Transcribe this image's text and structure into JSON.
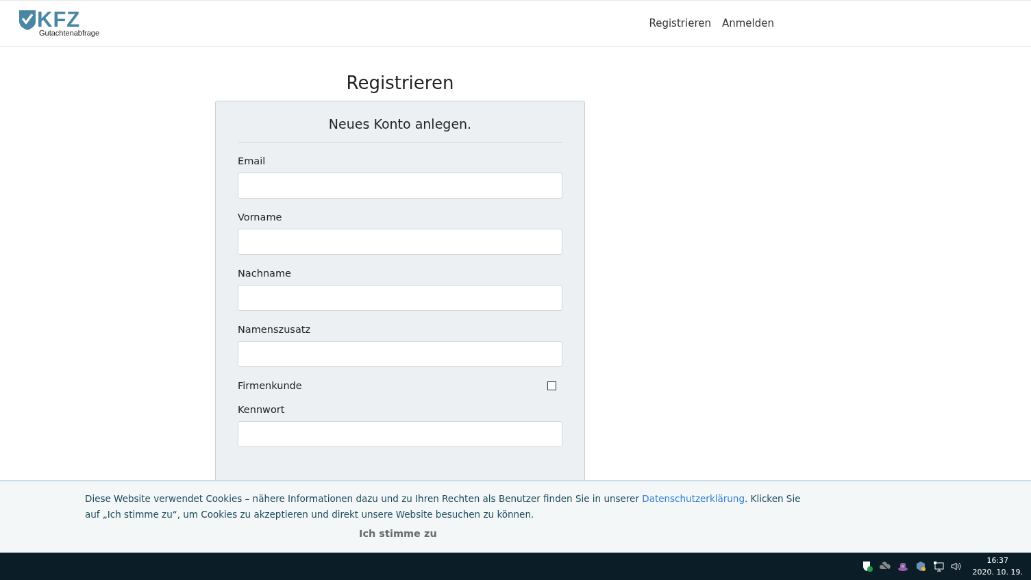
{
  "logo": {
    "title": "KFZ",
    "subtitle": "Gutachtenabfrage"
  },
  "nav": [
    {
      "label": "Registrieren"
    },
    {
      "label": "Anmelden"
    }
  ],
  "page_title": "Registrieren",
  "card": {
    "heading": "Neues Konto anlegen.",
    "fields": [
      {
        "kind": "text",
        "label": "Email"
      },
      {
        "kind": "text",
        "label": "Vorname"
      },
      {
        "kind": "text",
        "label": "Nachname"
      },
      {
        "kind": "text",
        "label": "Namenszusatz"
      },
      {
        "kind": "checkbox",
        "label": "Firmenkunde",
        "checked": false
      },
      {
        "kind": "text",
        "label": "Kennwort"
      }
    ]
  },
  "cookie_banner": {
    "text_before": "Diese Website verwendet Cookies – nähere Informationen dazu und zu Ihren Rechten als Benutzer finden Sie in unserer ",
    "link": "Datenschutzerklärung",
    "text_after": ". Klicken Sie auf „Ich stimme zu“, um Cookies zu akzeptieren und direkt unsere Website besuchen zu können.",
    "button": "Ich stimme zu"
  },
  "taskbar": {
    "time": "16:37",
    "date": "2020. 10. 19."
  }
}
